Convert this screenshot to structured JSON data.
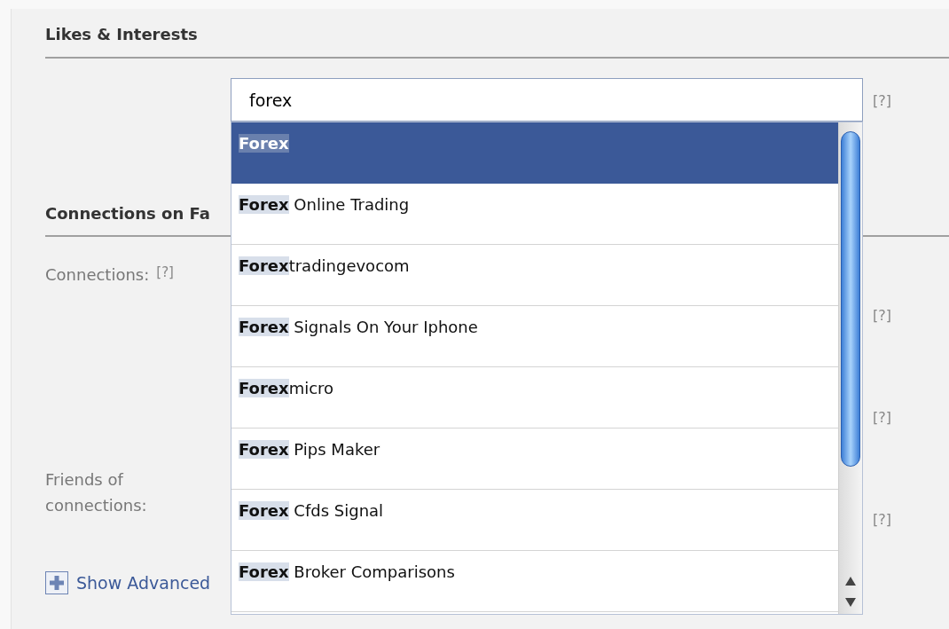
{
  "likes_section": {
    "title": "Likes & Interests",
    "field": {
      "value": "forex"
    },
    "help": "[?]"
  },
  "connections_section": {
    "title": "Connections on Fa",
    "label": "Connections:",
    "label_help": "[?]",
    "help_markers": [
      "[?]",
      "[?]",
      "[?]"
    ],
    "friends_label": "Friends of connections:"
  },
  "advanced_link": "Show Advanced",
  "suggestions": [
    {
      "match": "Forex",
      "selected": true
    },
    {
      "match": "Forex",
      "rest": " Online Trading",
      "selected": false
    },
    {
      "match": "Forex",
      "rest": "tradingevocom",
      "selected": false
    },
    {
      "match": "Forex",
      "rest": " Signals On Your Iphone",
      "selected": false
    },
    {
      "match": "Forex",
      "rest": "micro",
      "selected": false
    },
    {
      "match": "Forex",
      "rest": " Pips Maker",
      "selected": false
    },
    {
      "match": "Forex",
      "rest": " Cfds Signal",
      "selected": false
    },
    {
      "match": "Forex",
      "rest": " Broker Comparisons",
      "selected": false
    }
  ]
}
